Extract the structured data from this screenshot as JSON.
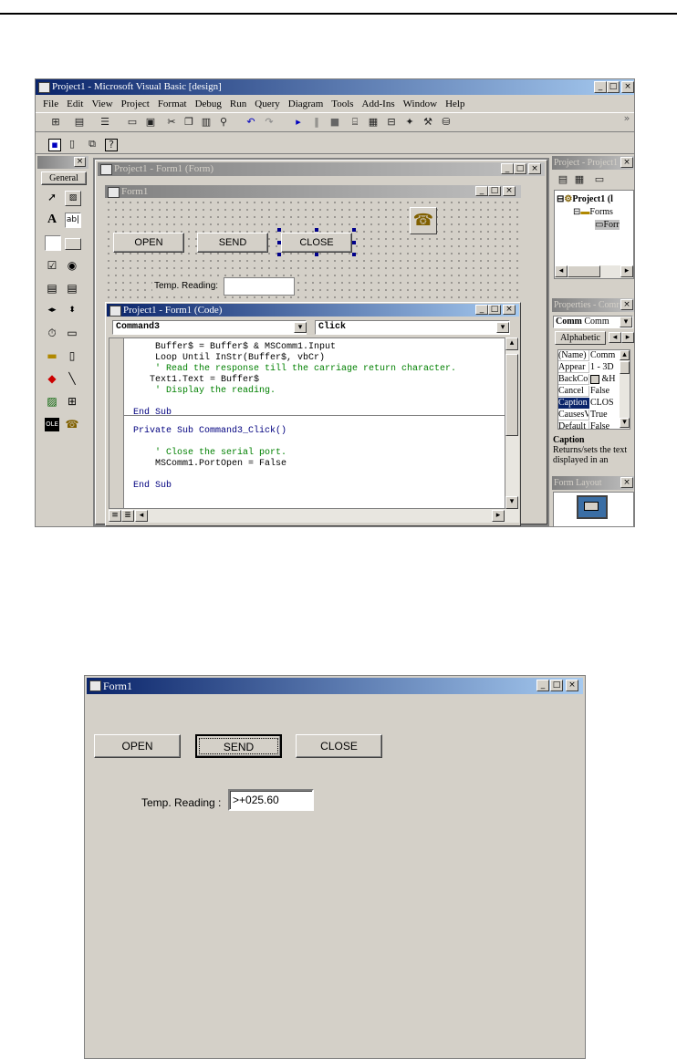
{
  "shot1": {
    "window_title": "Project1 - Microsoft Visual Basic [design]",
    "menu": [
      "File",
      "Edit",
      "View",
      "Project",
      "Format",
      "Debug",
      "Run",
      "Query",
      "Diagram",
      "Tools",
      "Add-Ins",
      "Window",
      "Help"
    ],
    "toolbox_tab": "General",
    "form_window_title": "Project1 - Form1 (Form)",
    "form_title": "Form1",
    "buttons": {
      "open": "OPEN",
      "send": "SEND",
      "close": "CLOSE"
    },
    "temp_label": "Temp. Reading:",
    "code_window_title": "Project1 - Form1 (Code)",
    "object_combo": "Command3",
    "proc_combo": "Click",
    "code_lines": [
      "    Buffer$ = Buffer$ & MSComm1.Input",
      "    Loop Until InStr(Buffer$, vbCr)",
      "    ' Read the response till the carriage return character.",
      "   Text1.Text = Buffer$",
      "    ' Display the reading.",
      "",
      "End Sub"
    ],
    "code_lines_2": [
      "Private Sub Command3_Click()",
      "",
      "    ' Close the serial port.",
      "    MSComm1.PortOpen = False",
      "",
      "End Sub"
    ],
    "project_pane": {
      "title": "Project - Project1",
      "root": "Project1 (l",
      "folder": "Forms",
      "item": "Forr"
    },
    "properties_pane": {
      "title": "Properties - Comr",
      "object": "Comm",
      "object_type": "Comm",
      "tab": "Alphabetic",
      "rows": [
        [
          "(Name)",
          "Comm"
        ],
        [
          "Appear",
          "1 - 3D"
        ],
        [
          "BackCo",
          "&H"
        ],
        [
          "Cancel",
          "False"
        ],
        [
          "Caption",
          "CLOS"
        ],
        [
          "CausesV",
          "True"
        ],
        [
          "Default",
          "False"
        ]
      ],
      "desc_title": "Caption",
      "desc_text": "Returns/sets the text displayed in an"
    },
    "layout_pane": {
      "title": "Form Layout"
    }
  },
  "shot2": {
    "window_title": "Form1",
    "buttons": {
      "open": "OPEN",
      "send": "SEND",
      "close": "CLOSE"
    },
    "temp_label": "Temp. Reading :",
    "temp_value": ">+025.60"
  }
}
